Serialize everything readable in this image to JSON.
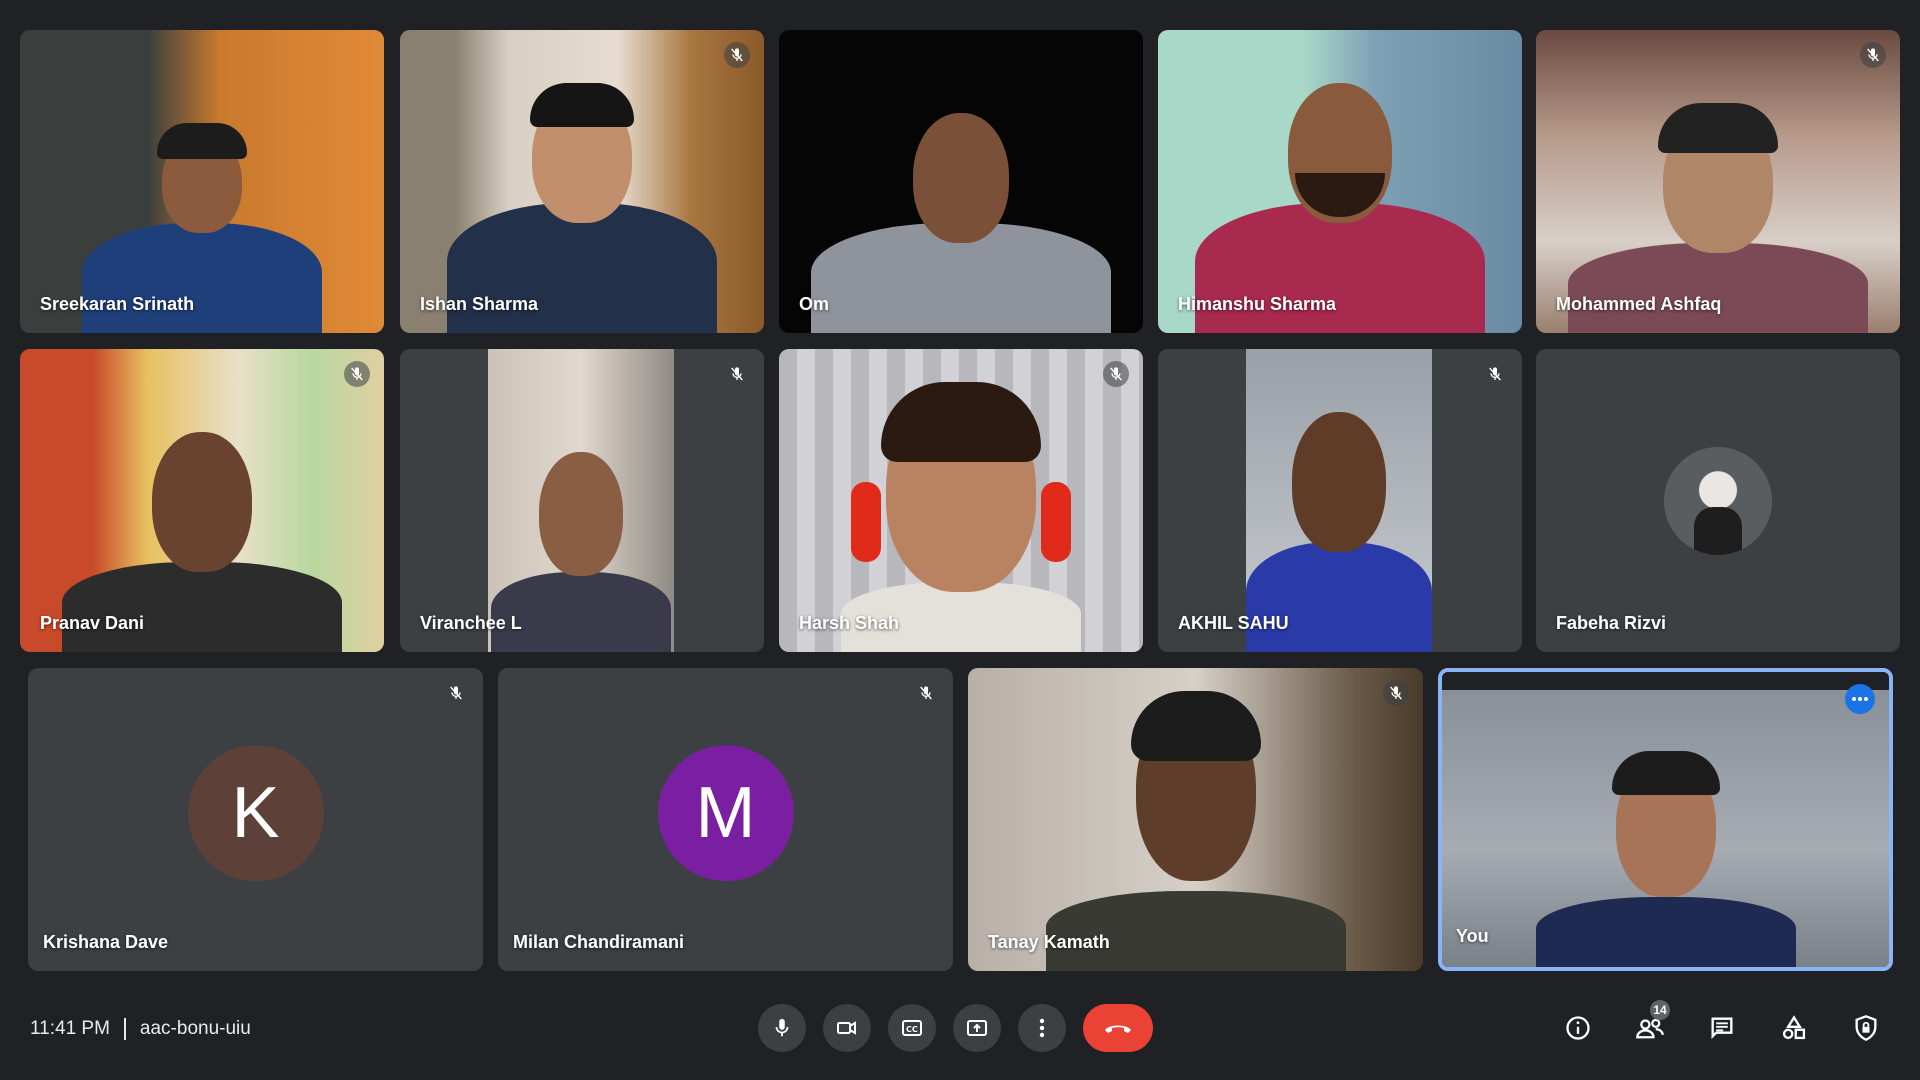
{
  "participants_row1": [
    {
      "name": "Sreekaran Srinath"
    },
    {
      "name": "Ishan Sharma"
    },
    {
      "name": "Om"
    },
    {
      "name": "Himanshu Sharma"
    },
    {
      "name": "Mohammed Ashfaq"
    }
  ],
  "participants_row2": [
    {
      "name": "Pranav Dani"
    },
    {
      "name": "Viranchee L"
    },
    {
      "name": "Harsh Shah"
    },
    {
      "name": "AKHIL SAHU"
    },
    {
      "name": "Fabeha Rizvi"
    }
  ],
  "participants_row3": [
    {
      "name": "Krishana Dave",
      "initial": "K"
    },
    {
      "name": "Milan Chandiramani",
      "initial": "M"
    },
    {
      "name": "Tanay Kamath"
    },
    {
      "name": "You"
    }
  ],
  "meeting": {
    "time": "11:41 PM",
    "code": "aac-bonu-uiu"
  },
  "people_count": "14",
  "colors": {
    "background": "#202124",
    "tile": "#3c4043",
    "end_call": "#ea4335",
    "avatar_k": "#5d4037",
    "avatar_m": "#7b1fa2",
    "self_border": "#8ab4f8",
    "accent": "#1a73e8"
  },
  "icons": {
    "muted": "mic-off-icon",
    "more": "more-horiz-icon",
    "mic": "mic-icon",
    "camera": "videocam-icon",
    "captions": "closed-caption-icon",
    "present": "present-screen-icon",
    "more_options": "more-vert-icon",
    "end_call": "call-end-icon",
    "info": "info-icon",
    "people": "people-icon",
    "chat": "chat-icon",
    "activities": "activities-icon",
    "host_controls": "lock-shield-icon"
  }
}
